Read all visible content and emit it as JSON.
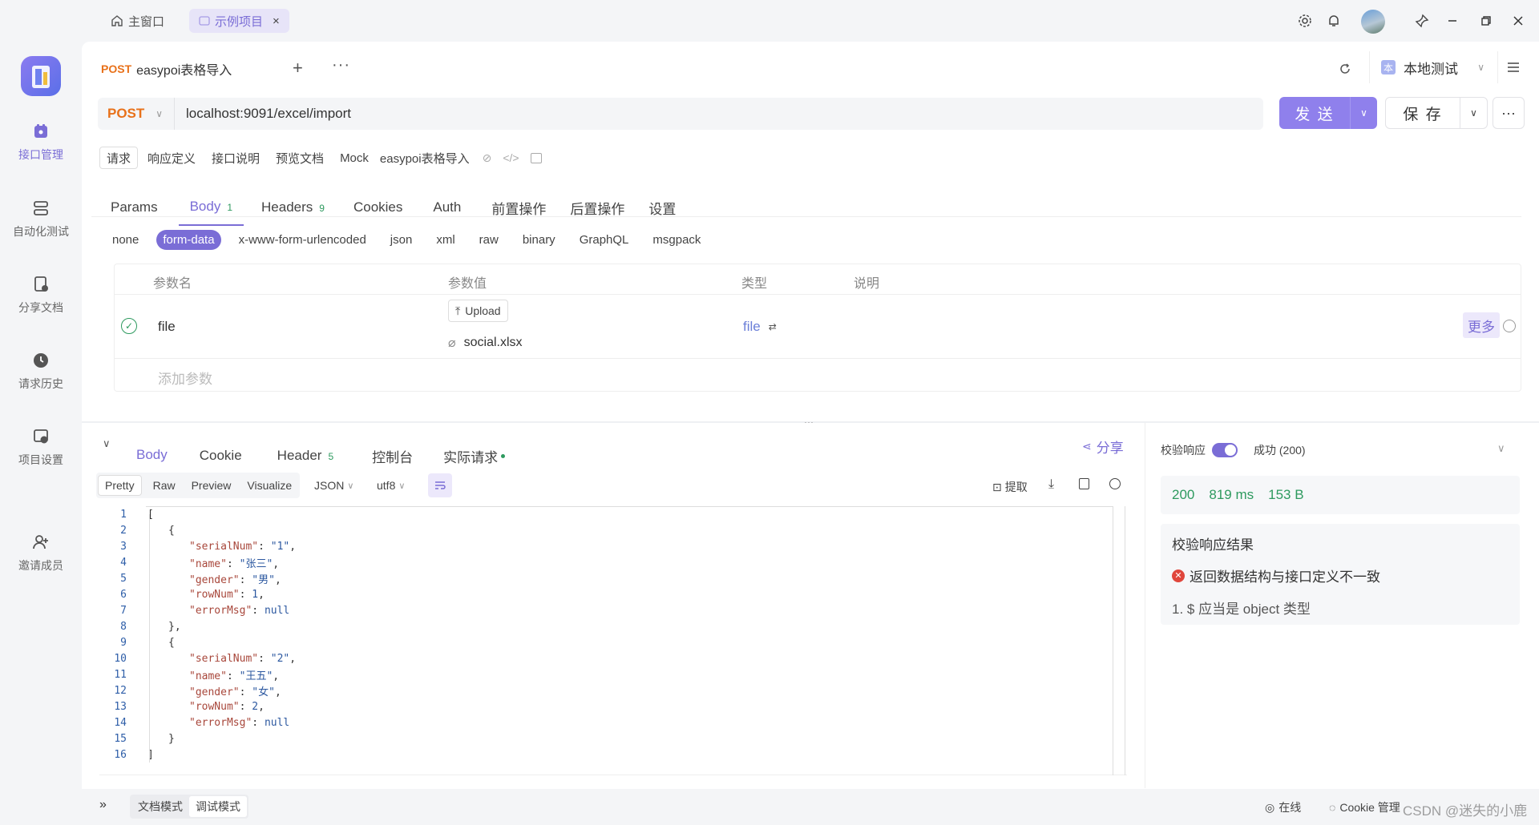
{
  "titlebar": {
    "home_tab": "主窗口",
    "project_tab": "示例项目",
    "close": "×"
  },
  "leftnav": {
    "items": [
      {
        "label": "接口管理",
        "icon": "api-icon",
        "active": true
      },
      {
        "label": "自动化测试",
        "icon": "automation-icon"
      },
      {
        "label": "分享文档",
        "icon": "share-doc-icon"
      },
      {
        "label": "请求历史",
        "icon": "history-icon"
      },
      {
        "label": "项目设置",
        "icon": "settings-icon"
      },
      {
        "label": "邀请成员",
        "icon": "invite-user-icon"
      }
    ]
  },
  "request_tab": {
    "method": "POST",
    "name": "easypoi表格导入"
  },
  "environment": {
    "badge": "本",
    "label": "本地测试"
  },
  "urlbar": {
    "method": "POST",
    "url": "localhost:9091/excel/import",
    "send_label": "发 送",
    "save_label": "保 存"
  },
  "subtabs": {
    "items": [
      "请求",
      "响应定义",
      "接口说明",
      "预览文档",
      "Mock"
    ],
    "endpoint_name": "easypoi表格导入"
  },
  "param_tabs": [
    {
      "label": "Params"
    },
    {
      "label": "Body",
      "badge": "1"
    },
    {
      "label": "Headers",
      "badge": "9"
    },
    {
      "label": "Cookies"
    },
    {
      "label": "Auth"
    },
    {
      "label": "前置操作"
    },
    {
      "label": "后置操作"
    },
    {
      "label": "设置"
    }
  ],
  "body_types": [
    "none",
    "form-data",
    "x-www-form-urlencoded",
    "json",
    "xml",
    "raw",
    "binary",
    "GraphQL",
    "msgpack"
  ],
  "param_table": {
    "headers": [
      "参数名",
      "参数值",
      "类型",
      "说明"
    ],
    "row": {
      "name": "file",
      "upload_label": "Upload",
      "file_name": "social.xlsx",
      "type": "file",
      "more": "更多"
    },
    "add_placeholder": "添加参数"
  },
  "response_tabs": [
    {
      "label": "Body"
    },
    {
      "label": "Cookie"
    },
    {
      "label": "Header",
      "badge": "5"
    },
    {
      "label": "控制台"
    },
    {
      "label": "实际请求"
    }
  ],
  "share_label": "分享",
  "view_tabs": [
    "Pretty",
    "Raw",
    "Preview",
    "Visualize"
  ],
  "format": {
    "type": "JSON",
    "encoding": "utf8"
  },
  "extract_label": "提取",
  "code_lines": [
    {
      "n": "1",
      "indent": 0,
      "text": "["
    },
    {
      "n": "2",
      "indent": 1,
      "text": "{"
    },
    {
      "n": "3",
      "indent": 2,
      "k": "\"serialNum\"",
      "v": "\"1\"",
      "t": "str",
      "end": ","
    },
    {
      "n": "4",
      "indent": 2,
      "k": "\"name\"",
      "v": "\"张三\"",
      "t": "str",
      "end": ","
    },
    {
      "n": "5",
      "indent": 2,
      "k": "\"gender\"",
      "v": "\"男\"",
      "t": "str",
      "end": ","
    },
    {
      "n": "6",
      "indent": 2,
      "k": "\"rowNum\"",
      "v": "1",
      "t": "num",
      "end": ","
    },
    {
      "n": "7",
      "indent": 2,
      "k": "\"errorMsg\"",
      "v": "null",
      "t": "nul",
      "end": ""
    },
    {
      "n": "8",
      "indent": 1,
      "text": "},"
    },
    {
      "n": "9",
      "indent": 1,
      "text": "{"
    },
    {
      "n": "10",
      "indent": 2,
      "k": "\"serialNum\"",
      "v": "\"2\"",
      "t": "str",
      "end": ","
    },
    {
      "n": "11",
      "indent": 2,
      "k": "\"name\"",
      "v": "\"王五\"",
      "t": "str",
      "end": ","
    },
    {
      "n": "12",
      "indent": 2,
      "k": "\"gender\"",
      "v": "\"女\"",
      "t": "str",
      "end": ","
    },
    {
      "n": "13",
      "indent": 2,
      "k": "\"rowNum\"",
      "v": "2",
      "t": "num",
      "end": ","
    },
    {
      "n": "14",
      "indent": 2,
      "k": "\"errorMsg\"",
      "v": "null",
      "t": "nul",
      "end": ""
    },
    {
      "n": "15",
      "indent": 1,
      "text": "}"
    },
    {
      "n": "16",
      "indent": 0,
      "text": "]"
    }
  ],
  "validation": {
    "label": "校验响应",
    "status_option": "成功 (200)",
    "code": "200",
    "time": "819 ms",
    "size": "153 B",
    "result_title": "校验响应结果",
    "error": "返回数据结构与接口定义不一致",
    "detail": "1. $ 应当是 object 类型"
  },
  "statusbar": {
    "doc_mode": "文档模式",
    "debug_mode": "调试模式",
    "online": "在线",
    "cookie": "Cookie 管理",
    "watermark": "CSDN @迷失的小鹿"
  },
  "colors": {
    "accent": "#7a6dd6",
    "send": "#8f80ec",
    "method_post": "#e8711a",
    "success": "#2e9a5f",
    "error": "#e0463c"
  }
}
